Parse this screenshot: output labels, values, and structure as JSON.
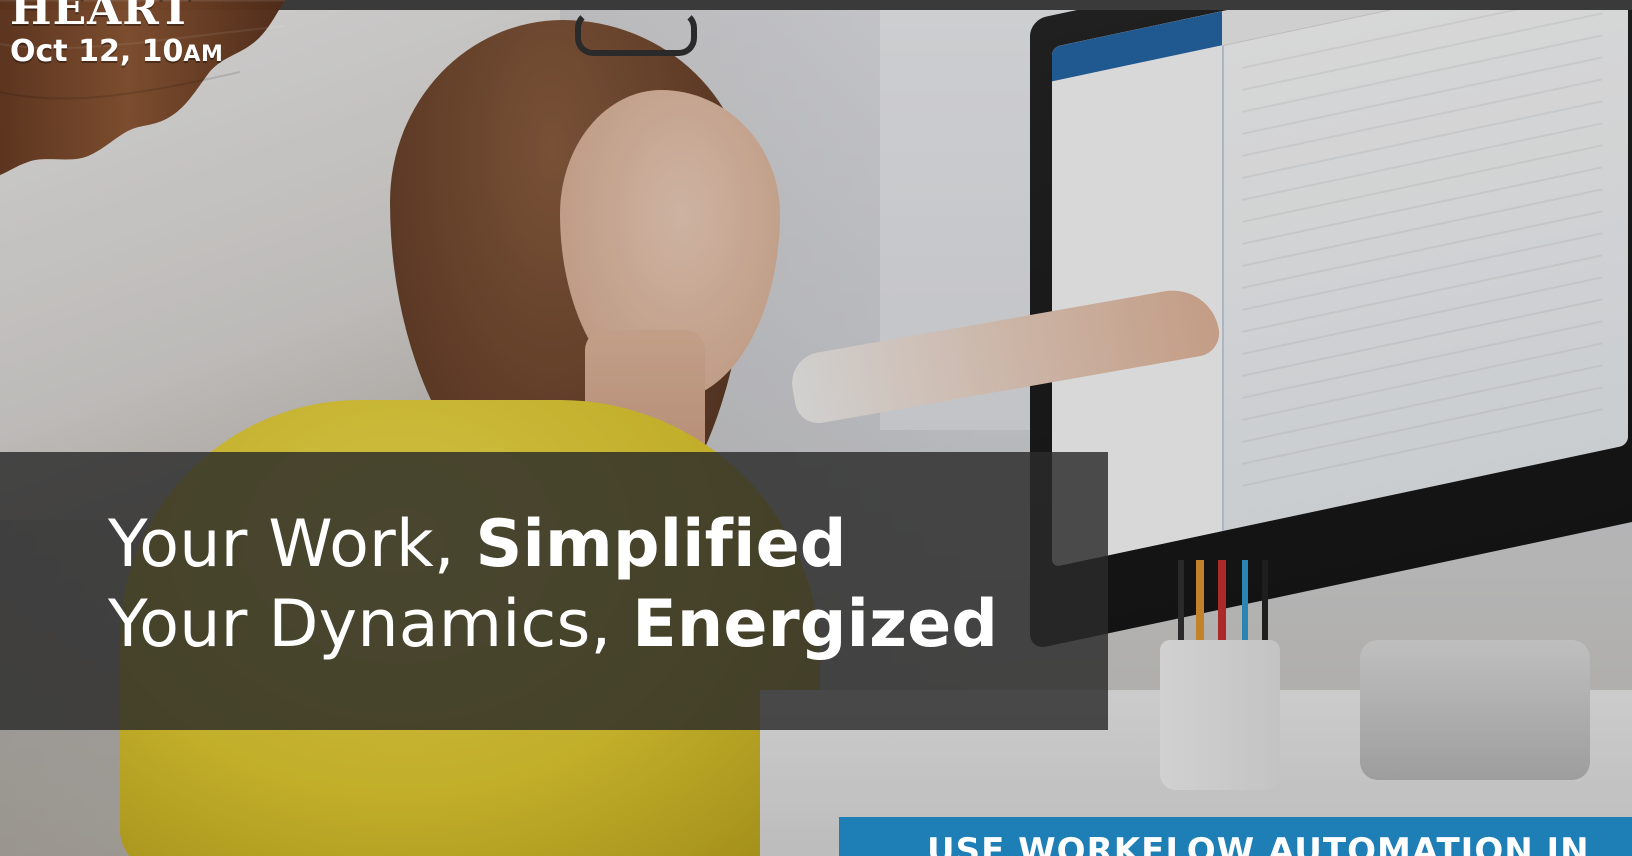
{
  "event": {
    "title": "HEART",
    "date_main": "Oct 12, 10",
    "date_suffix": "AM"
  },
  "hero": {
    "line1_regular": "Your Work, ",
    "line1_bold": "Simplified",
    "line2_regular": "Your Dynamics, ",
    "line2_bold": "Energized"
  },
  "cta": {
    "label": "USE WORKFLOW AUTOMATION IN"
  },
  "colors": {
    "cta_bg": "#1e7fb7",
    "overlay": "#2b2b2b",
    "text": "#ffffff",
    "badge_wood": "#6a3f25",
    "top_bar": "#3a3a3a"
  },
  "icons": {
    "badge_shape": "wood-badge-icon"
  }
}
